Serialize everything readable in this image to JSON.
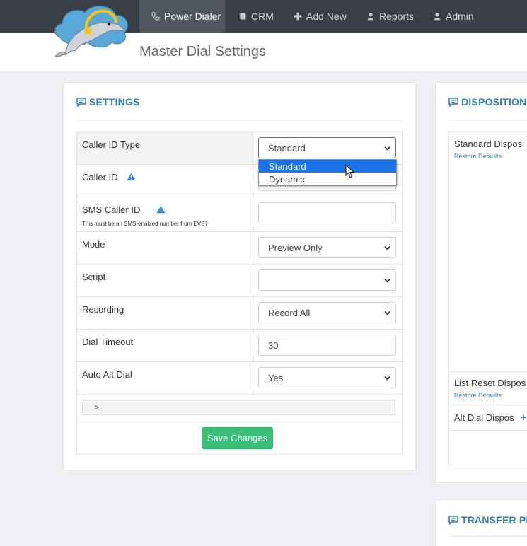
{
  "nav": {
    "items": [
      {
        "label": "Power Dialer",
        "icon": "phone-icon",
        "active": true
      },
      {
        "label": "CRM",
        "icon": "book-icon"
      },
      {
        "label": "Add New",
        "icon": "plus-icon"
      },
      {
        "label": "Reports",
        "icon": "user-icon"
      },
      {
        "label": "Admin",
        "icon": "user-icon"
      }
    ]
  },
  "page": {
    "title": "Master Dial Settings"
  },
  "settings": {
    "title": "SETTINGS",
    "rows": {
      "caller_id_type": {
        "label": "Caller ID Type",
        "value": "Standard"
      },
      "caller_id": {
        "label": "Caller ID"
      },
      "sms_caller_id": {
        "label": "SMS Caller ID",
        "hint": "This must be an SMS-enabled number from EVS7",
        "value": ""
      },
      "mode": {
        "label": "Mode",
        "value": "Preview Only"
      },
      "script": {
        "label": "Script",
        "value": ""
      },
      "recording": {
        "label": "Recording",
        "value": "Record All"
      },
      "dial_timeout": {
        "label": "Dial Timeout",
        "value": "30"
      },
      "auto_alt_dial": {
        "label": "Auto Alt Dial",
        "value": "Yes"
      }
    },
    "collapser": ">",
    "save_label": "Save Changes"
  },
  "dropdown": {
    "options": [
      "Standard",
      "Dynamic"
    ],
    "highlighted": "Standard"
  },
  "dispositions": {
    "title": "DISPOSITIONS",
    "standard_label": "Standard Dispos",
    "standard_restore": "Restore Defaults",
    "list_reset_label": "List Reset Dispos",
    "list_reset_restore": "Restore Defaults",
    "alt_dial_label": "Alt Dial Dispos",
    "alt_dial_add": "+"
  },
  "transfer": {
    "title": "TRANSFER PR"
  },
  "colors": {
    "accent": "#2e7fb7",
    "nav_bg": "#3a3f47",
    "success": "#3cbf79",
    "highlight": "#1a73e8"
  }
}
